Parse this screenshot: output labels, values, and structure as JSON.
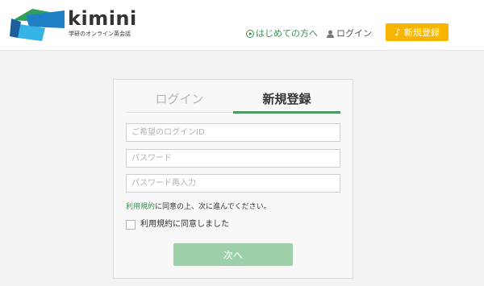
{
  "brand": {
    "name": "kimini",
    "tagline": "学研のオンライン英会話",
    "colors": {
      "green": "#3f8f4f",
      "blue": "#1e7fc4",
      "yellow": "#f7b500"
    }
  },
  "nav": {
    "first_time_label": "はじめての方へ",
    "first_time_icon": "play-circle-icon",
    "login_label": "ログイン",
    "login_icon": "person-icon",
    "register_label": "新規登録",
    "register_icon": "music-note-icon"
  },
  "form": {
    "tabs": [
      {
        "label": "ログイン",
        "active": false
      },
      {
        "label": "新規登録",
        "active": true
      }
    ],
    "login_id_placeholder": "ご希望のログインID",
    "password_placeholder": "パスワード",
    "password_confirm_placeholder": "パスワード再入力",
    "terms_link": "利用規約",
    "terms_note_rest": "に同意の上、次に進んでください。",
    "agree_label": "利用規約に同意しました",
    "agree_checked": false,
    "next_label": "次へ"
  }
}
